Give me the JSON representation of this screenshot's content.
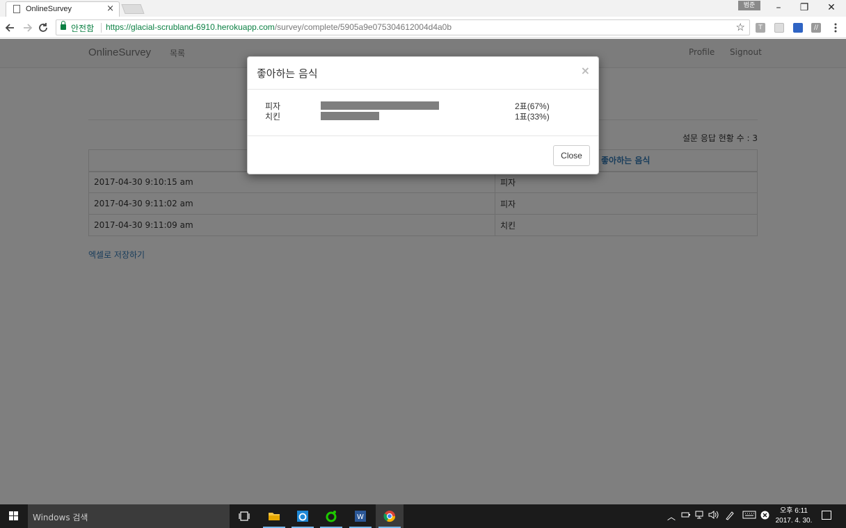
{
  "browser": {
    "tab_title": "OnlineSurvey",
    "tab_close": "×",
    "profile_badge": "범준",
    "win_minimize": "–",
    "win_restore": "❐",
    "win_close": "✕",
    "secure_label": "안전함",
    "url_host": "https://glacial-scrubland-6910.herokuapp.com",
    "url_path": "/survey/complete/5905a9e075304612004d4a0b",
    "ext_labels": [
      "T",
      "",
      "",
      "//"
    ]
  },
  "navbar": {
    "brand": "OnlineSurvey",
    "list_link": "목록",
    "profile_link": "Profile",
    "signout_link": "Signout"
  },
  "page": {
    "response_count": "설문 응답 현황 수 : 3",
    "table": {
      "headers": [
        "",
        "좋아하는 음식"
      ],
      "rows": [
        {
          "time": "2017-04-30 9:10:15 am",
          "answer": "피자"
        },
        {
          "time": "2017-04-30 9:11:02 am",
          "answer": "피자"
        },
        {
          "time": "2017-04-30 9:11:09 am",
          "answer": "치킨"
        }
      ]
    },
    "excel_link": "엑셀로 저장하기"
  },
  "modal": {
    "title": "좋아하는 음식",
    "close_icon": "×",
    "results": [
      {
        "label": "피자",
        "fraction": 0.67,
        "count_text": "2표(67%)"
      },
      {
        "label": "치킨",
        "fraction": 0.33,
        "count_text": "1표(33%)"
      }
    ],
    "close_button": "Close"
  },
  "taskbar": {
    "search_placeholder": "Windows 검색",
    "clock_time": "오후 6:11",
    "clock_date": "2017. 4. 30."
  },
  "colors": {
    "link": "#337ab7",
    "secure": "#0b8043",
    "bar": "#7f7f7f",
    "taskbar": "#1b1b1b"
  }
}
